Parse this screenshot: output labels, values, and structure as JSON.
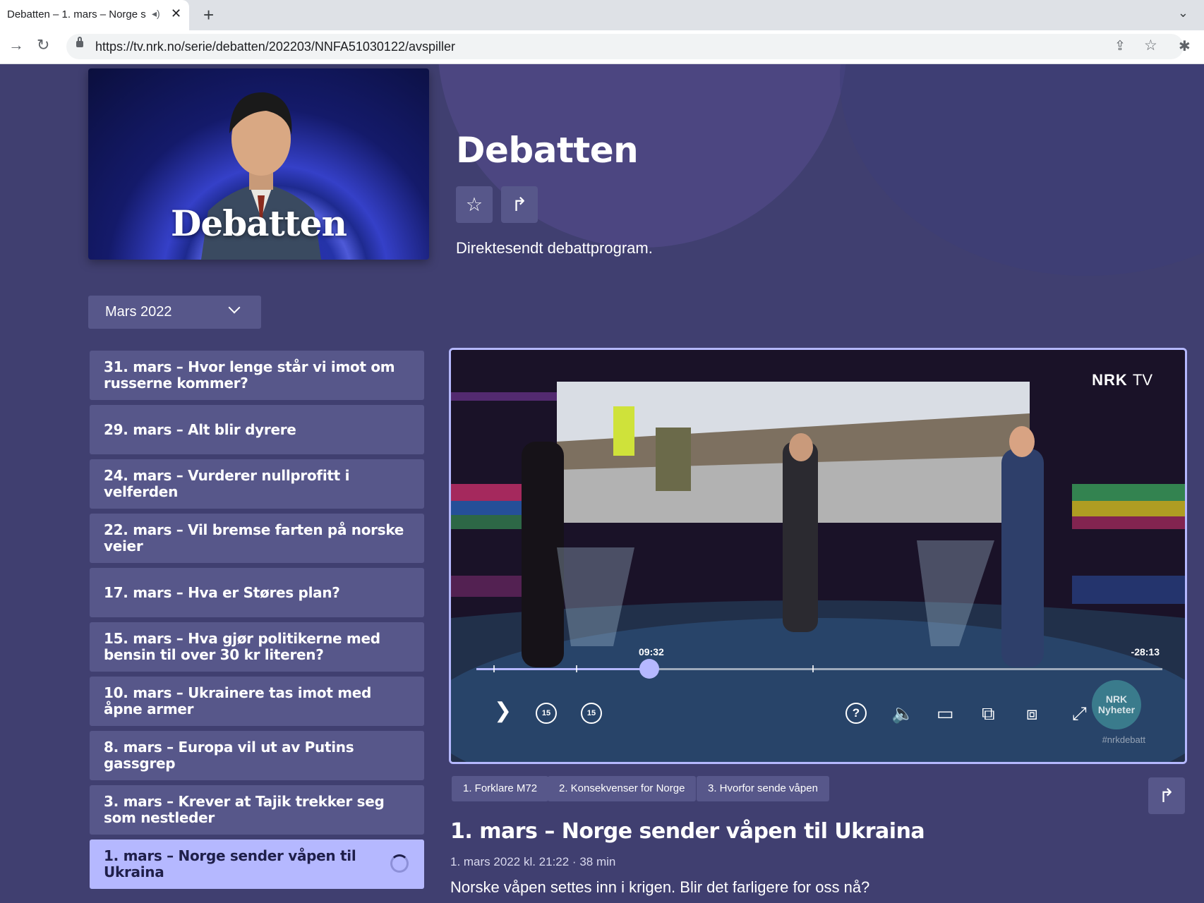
{
  "browser": {
    "tab_title": "Debatten – 1. mars – Norge s",
    "audio_icon": "speaker-icon",
    "close_glyph": "✕",
    "new_tab_glyph": "+",
    "menu_glyph": "⌄",
    "back_glyph": "→",
    "reload_glyph": "↻",
    "url": "https://tv.nrk.no/serie/debatten/202203/NNFA51030122/avspiller",
    "share_glyph": "⇪",
    "star_glyph": "☆",
    "extensions_glyph": "✱"
  },
  "series": {
    "poster_logo": "Debatten",
    "title": "Debatten",
    "favorite_glyph": "☆",
    "share_glyph": "↱",
    "description": "Direktesendt debattprogram."
  },
  "season_select": {
    "selected": "Mars 2022"
  },
  "episodes": [
    {
      "label": "31. mars – Hvor lenge står vi imot om russerne kommer?"
    },
    {
      "label": "29. mars – Alt blir dyrere"
    },
    {
      "label": "24. mars – Vurderer nullprofitt i velferden"
    },
    {
      "label": "22. mars – Vil bremse farten på norske veier"
    },
    {
      "label": "17. mars – Hva er Støres plan?"
    },
    {
      "label": "15. mars – Hva gjør politikerne med bensin til over 30 kr literen?"
    },
    {
      "label": "10. mars – Ukrainere tas imot med åpne armer"
    },
    {
      "label": "8. mars – Europa vil ut av Putins gassgrep"
    },
    {
      "label": "3. mars – Krever at Tajik trekker seg som nestleder"
    },
    {
      "label": "1. mars – Norge sender våpen til Ukraina",
      "active": true
    }
  ],
  "player": {
    "logo_main": "NRK",
    "logo_suffix": "TV",
    "elapsed": "09:32",
    "remaining": "-28:13",
    "progress": 0.252,
    "chapter_marks": [
      0.025,
      0.145,
      0.49
    ],
    "play_glyph": "❯",
    "rewind_label": "15",
    "forward_label": "15",
    "help_glyph": "?",
    "volume_glyph": "🔈",
    "subtitles_glyph": "▭",
    "cast_glyph": "⧉",
    "pip_glyph": "⧈",
    "fullscreen_glyph": "⤢",
    "badge_text": "NRK Nyheter",
    "hashtag": "#nrkdebatt"
  },
  "chapters": [
    {
      "label": "1. Forklare M72"
    },
    {
      "label": "2. Konsekvenser for Norge"
    },
    {
      "label": "3. Hvorfor sende våpen"
    }
  ],
  "episode": {
    "share_glyph": "↱",
    "title": "1. mars – Norge sender våpen til Ukraina",
    "meta": "1. mars 2022 kl. 21:22  ·  38 min",
    "description": "Norske våpen settes inn i krigen. Blir det farligere for oss nå?"
  },
  "colors": {
    "page_background": "#403f70",
    "tile": "#57578a",
    "accent": "#b5b8ff"
  }
}
